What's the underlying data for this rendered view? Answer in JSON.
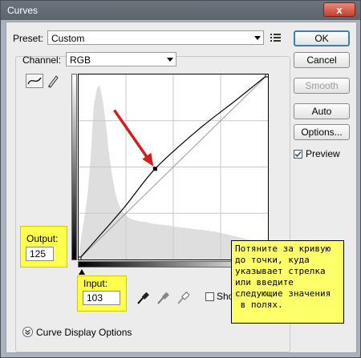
{
  "window": {
    "title": "Curves",
    "close_glyph": "x"
  },
  "preset": {
    "label": "Preset:",
    "value": "Custom",
    "menu_icon": "preset-options-icon"
  },
  "channel": {
    "label": "Channel:",
    "value": "RGB"
  },
  "buttons": {
    "ok": "OK",
    "cancel": "Cancel",
    "smooth": "Smooth",
    "auto": "Auto",
    "options": "Options..."
  },
  "preview": {
    "label": "Preview",
    "checked": true
  },
  "tools": {
    "curve_tool": "curve-point-icon",
    "pencil_tool": "pencil-icon"
  },
  "output": {
    "label": "Output:",
    "value": "125"
  },
  "input": {
    "label": "Input:",
    "value": "103"
  },
  "eyedroppers": [
    "black-eyedropper-icon",
    "gray-eyedropper-icon",
    "white-eyedropper-icon"
  ],
  "show_clipping": {
    "label_visible": "Sho",
    "checked": false
  },
  "curve_display_options": {
    "label": "Curve Display Options"
  },
  "annotation": {
    "text": "Потяните за кривую\nдо точки, куда\nуказывает стрелка\nили введите\nследующие значения\n в полях."
  },
  "chart_data": {
    "type": "line",
    "xlim": [
      0,
      255
    ],
    "ylim": [
      0,
      255
    ],
    "grid": "4x4",
    "baseline": {
      "x": [
        0,
        255
      ],
      "y": [
        0,
        255
      ]
    },
    "curve": {
      "x": [
        0,
        60,
        103,
        160,
        210,
        255
      ],
      "y": [
        0,
        70,
        125,
        178,
        218,
        255
      ]
    },
    "control_point": {
      "x": 103,
      "y": 125
    },
    "histogram": [
      0,
      35,
      60,
      90,
      140,
      210,
      235,
      240,
      220,
      190,
      150,
      120,
      95,
      80,
      70,
      64,
      60,
      57,
      55,
      54,
      53,
      52,
      52,
      51,
      50,
      49,
      49,
      48,
      48,
      47,
      47,
      46,
      45,
      45,
      44,
      44,
      43,
      43,
      42,
      42,
      41,
      41,
      40,
      40,
      39,
      39,
      38,
      37,
      36,
      35,
      34,
      33,
      32,
      31,
      30,
      29,
      28,
      27,
      26,
      24,
      22,
      20,
      18,
      12
    ],
    "accent": "#d11f1f"
  }
}
